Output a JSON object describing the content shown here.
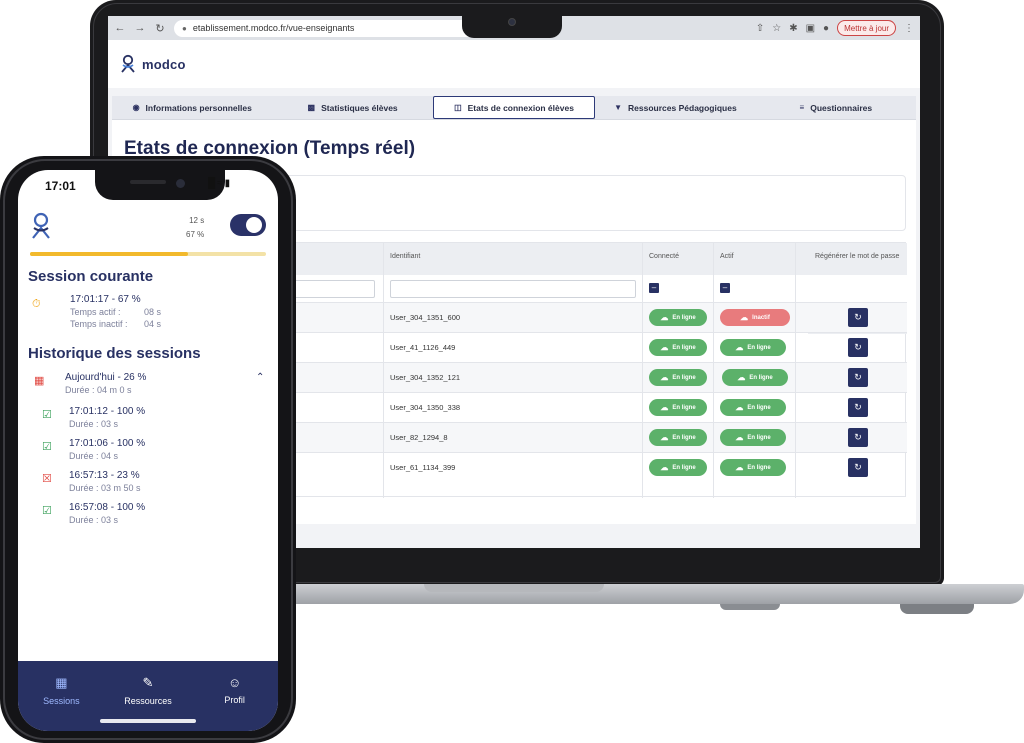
{
  "browser": {
    "url": "etablissement.modco.fr/vue-enseignants",
    "update_label": "Mettre à jour"
  },
  "app": {
    "logo_text": "modco"
  },
  "tabs": [
    {
      "label": "Informations personnelles",
      "icon": "user-circle-icon"
    },
    {
      "label": "Statistiques élèves",
      "icon": "chart-icon"
    },
    {
      "label": "Etats de connexion élèves",
      "icon": "door-icon",
      "active": true
    },
    {
      "label": "Ressources Pédagogiques",
      "icon": "basket-icon"
    },
    {
      "label": "Questionnaires",
      "icon": "checklist-icon"
    }
  ],
  "page": {
    "title": "Etats de connexion (Temps réel)"
  },
  "table": {
    "headers": {
      "identifiant": "Identifiant",
      "connecte": "Connecté",
      "actif": "Actif",
      "regen": "Régénérer le mot de passe"
    },
    "rows": [
      {
        "id": "User_304_1351_600",
        "connecte": "En ligne",
        "actif": "Inactif",
        "actif_status": "inactive"
      },
      {
        "id": "User_41_1126_449",
        "connecte": "En ligne",
        "actif": "En ligne",
        "actif_status": "active"
      },
      {
        "id": "User_304_1352_121",
        "connecte": "En ligne",
        "actif": "En ligne",
        "actif_status": "active"
      },
      {
        "id": "User_304_1350_338",
        "connecte": "En ligne",
        "actif": "En ligne",
        "actif_status": "active"
      },
      {
        "id": "User_82_1294_8",
        "connecte": "En ligne",
        "actif": "En ligne",
        "actif_status": "active"
      },
      {
        "id": "User_61_1134_399",
        "connecte": "En ligne",
        "actif": "En ligne",
        "actif_status": "active"
      }
    ]
  },
  "phone": {
    "status_time": "17:01",
    "timer_seconds": "12 s",
    "timer_percent": "67 %",
    "progress_fraction": 0.67,
    "current_session": {
      "heading": "Session courante",
      "main": "17:01:17 - 67 %",
      "active_label": "Temps actif :",
      "active_value": "08 s",
      "inactive_label": "Temps inactif :",
      "inactive_value": "04 s"
    },
    "history": {
      "heading": "Historique des sessions",
      "day_label": "Aujourd'hui - 26 %",
      "day_duration": "Durée :  04 m 0 s",
      "sessions": [
        {
          "main": "17:01:12 - 100 %",
          "duration": "Durée :   03 s",
          "status": "complete"
        },
        {
          "main": "17:01:06 - 100 %",
          "duration": "Durée :   04 s",
          "status": "complete"
        },
        {
          "main": "16:57:13 - 23 %",
          "duration": "Durée :   03 m 50 s",
          "status": "partial"
        },
        {
          "main": "16:57:08 - 100 %",
          "duration": "Durée :   03 s",
          "status": "complete"
        }
      ]
    },
    "nav": [
      {
        "label": "Sessions",
        "icon": "calendar-icon",
        "active": true
      },
      {
        "label": "Ressources",
        "icon": "edit-note-icon"
      },
      {
        "label": "Profil",
        "icon": "person-icon"
      }
    ]
  },
  "colors": {
    "navy": "#283163",
    "green": "#5cb16a",
    "red": "#e87b7d",
    "amber": "#f2b92c"
  }
}
